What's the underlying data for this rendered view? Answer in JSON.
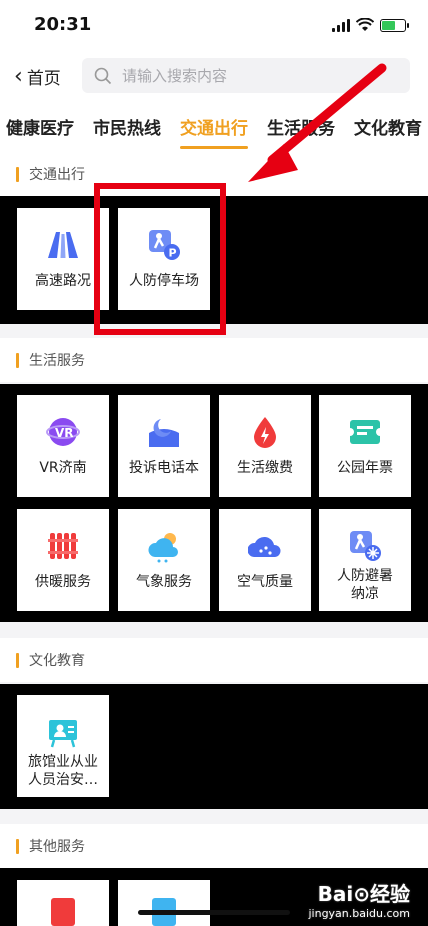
{
  "status_bar": {
    "time": "20:31"
  },
  "nav": {
    "back_label": "首页",
    "search_placeholder": "请输入搜索内容"
  },
  "tabs": [
    {
      "label": "健康医疗"
    },
    {
      "label": "市民热线"
    },
    {
      "label": "交通出行",
      "active": true
    },
    {
      "label": "生活服务"
    },
    {
      "label": "文化教育"
    }
  ],
  "sections": {
    "traffic": {
      "title": "交通出行",
      "items": [
        {
          "label": "高速路况",
          "icon": "highway-icon"
        },
        {
          "label": "人防停车场",
          "icon": "parking-icon"
        }
      ]
    },
    "life": {
      "title": "生活服务",
      "items": [
        {
          "label": "VR济南",
          "icon": "vr-icon"
        },
        {
          "label": "投诉电话本",
          "icon": "complaint-icon"
        },
        {
          "label": "生活缴费",
          "icon": "utility-icon"
        },
        {
          "label": "公园年票",
          "icon": "ticket-icon"
        },
        {
          "label": "供暖服务",
          "icon": "heating-icon"
        },
        {
          "label": "气象服务",
          "icon": "weather-icon"
        },
        {
          "label": "空气质量",
          "icon": "air-icon"
        },
        {
          "label": "人防避暑纳凉",
          "icon": "shelter-icon"
        }
      ]
    },
    "culture": {
      "title": "文化教育",
      "items": [
        {
          "label": "旅馆业从业人员治安…",
          "icon": "hotel-staff-icon"
        }
      ]
    },
    "other": {
      "title": "其他服务"
    }
  },
  "watermark": {
    "logo": "Bai⊙经验",
    "url": "jingyan.baidu.com"
  },
  "colors": {
    "accent": "#f0a020",
    "highlight": "#e60012",
    "icon_blue": "#4a6cf0"
  }
}
